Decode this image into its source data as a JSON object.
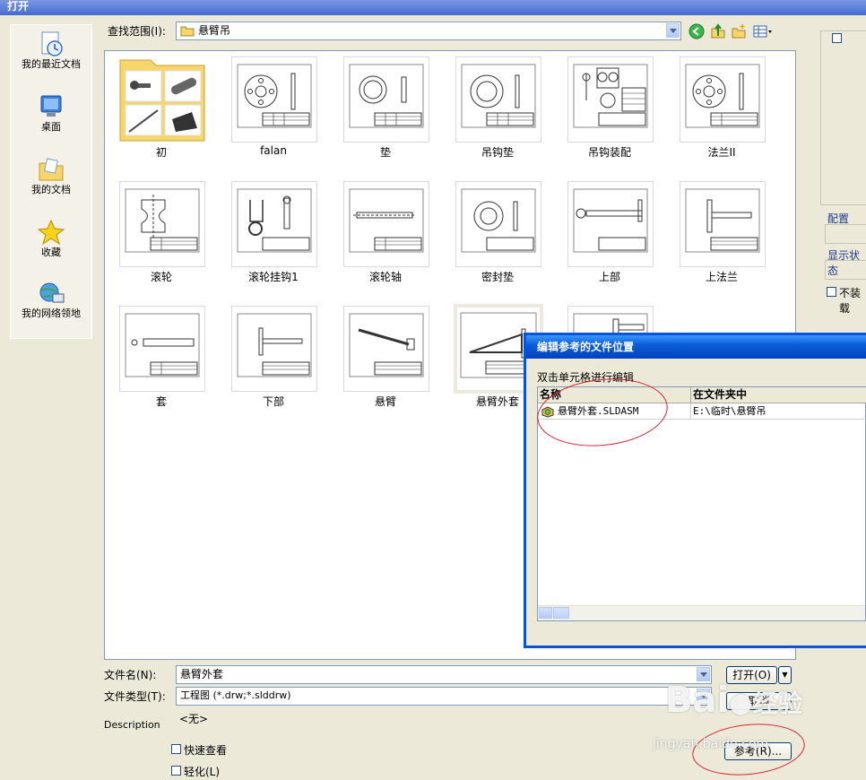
{
  "window": {
    "title": "打开"
  },
  "places": [
    {
      "label": "我的最近文档",
      "icon": "recent-documents-icon"
    },
    {
      "label": "桌面",
      "icon": "desktop-icon"
    },
    {
      "label": "我的文档",
      "icon": "my-documents-icon"
    },
    {
      "label": "收藏",
      "icon": "favorites-star-icon"
    },
    {
      "label": "我的网络领地",
      "icon": "network-places-icon"
    }
  ],
  "lookin": {
    "label": "查找范围(I):",
    "value": "悬臂吊"
  },
  "files": [
    {
      "name": "初",
      "type": "folder"
    },
    {
      "name": "falan",
      "type": "drawing"
    },
    {
      "name": "垫",
      "type": "drawing"
    },
    {
      "name": "吊钩垫",
      "type": "drawing"
    },
    {
      "name": "吊钩装配",
      "type": "drawing"
    },
    {
      "name": "法兰II",
      "type": "drawing"
    },
    {
      "name": "滚轮",
      "type": "drawing"
    },
    {
      "name": "滚轮挂钩1",
      "type": "drawing"
    },
    {
      "name": "滚轮轴",
      "type": "drawing"
    },
    {
      "name": "密封垫",
      "type": "drawing"
    },
    {
      "name": "上部",
      "type": "drawing"
    },
    {
      "name": "上法兰",
      "type": "drawing"
    },
    {
      "name": "套",
      "type": "drawing"
    },
    {
      "name": "下部",
      "type": "drawing"
    },
    {
      "name": "悬臂",
      "type": "drawing"
    },
    {
      "name": "悬臂外套",
      "type": "drawing",
      "selected": true
    },
    {
      "name": "",
      "type": "drawing"
    }
  ],
  "filename": {
    "label": "文件名(N):",
    "value": "悬臂外套"
  },
  "filetype": {
    "label": "文件类型(T):",
    "value": "工程图 (*.drw;*.slddrw)"
  },
  "description": {
    "label": "Description",
    "value": "<无>"
  },
  "buttons": {
    "open": "打开(O)",
    "cancel": "取消",
    "references": "参考(R)..."
  },
  "checkboxes": {
    "quick_view": "快速查看",
    "lightweight": "轻化(L)"
  },
  "right_panel": {
    "config": "配置",
    "display_state": "显示状态",
    "no_load": "不装载"
  },
  "refs_dialog": {
    "title": "编辑参考的文件位置",
    "hint": "双击单元格进行编辑",
    "columns": [
      "名称",
      "在文件夹中"
    ],
    "rows": [
      {
        "name": "悬臂外套.SLDASM",
        "folder": "E:\\临时\\悬臂吊"
      }
    ]
  },
  "watermark": {
    "brand": "Bai",
    "brand2": "经验",
    "url": "jingyan.baidu.com"
  },
  "colors": {
    "title_blue": "#0054e3",
    "annotation_red": "#d9232e"
  }
}
